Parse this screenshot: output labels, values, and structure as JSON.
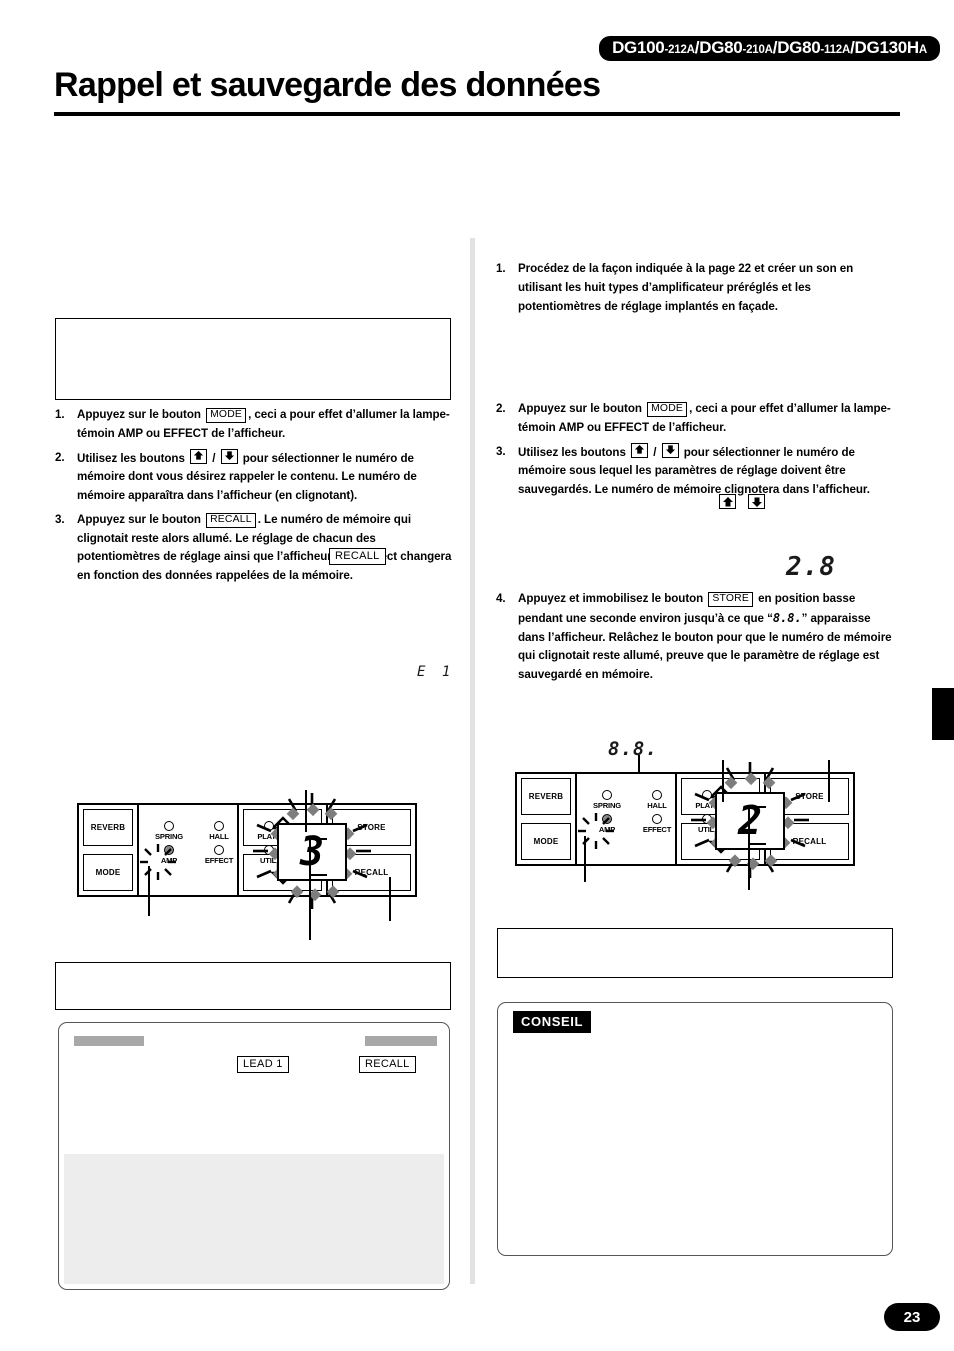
{
  "header": {
    "models_badge": "DG100-212A/DG80-210A/DG80-112A/DG130HA",
    "models": [
      {
        "name": "DG100",
        "suffix": "-212A"
      },
      {
        "name": "DG80",
        "suffix": "-210A"
      },
      {
        "name": "DG80",
        "suffix": "-112A"
      },
      {
        "name": "DG130H",
        "suffix": "A"
      }
    ],
    "title": "Rappel et sauvegarde des données"
  },
  "left_column": {
    "steps": [
      {
        "num": "1.",
        "parts": [
          {
            "t": "text",
            "v": "Appuyez sur le bouton "
          },
          {
            "t": "keycap",
            "v": "MODE"
          },
          {
            "t": "text",
            "v": ",  ceci a pour effet d’allumer la lampe-témoin AMP ou EFFECT de l’afficheur."
          }
        ]
      },
      {
        "num": "2.",
        "parts": [
          {
            "t": "text",
            "v": "Utilisez les boutons "
          },
          {
            "t": "arrow-up",
            "v": "up-arrow-key"
          },
          {
            "t": "text",
            "v": " / "
          },
          {
            "t": "arrow-down",
            "v": "down-arrow-key"
          },
          {
            "t": "text",
            "v": " pour sélectionner le numéro de mémoire dont vous désirez rappeler le contenu. Le numéro de mémoire apparaîtra dans l’afficheur (en clignotant)."
          }
        ]
      },
      {
        "num": "3.",
        "parts": [
          {
            "t": "text",
            "v": "Appuyez sur le bouton "
          },
          {
            "t": "keycap",
            "v": "RECALL"
          },
          {
            "t": "text",
            "v": ". Le numéro de mémoire qui clignotait reste alors allumé. Le réglage de chacun des potentiomètres de réglage ainsi que l’afficheur Amp Select changera en fonction des données rappelées de la mémoire."
          }
        ]
      }
    ],
    "callout_recall": "RECALL",
    "segment_readout": "E 1",
    "panel": {
      "left_buttons": [
        "REVERB",
        "MODE"
      ],
      "leds_top": [
        {
          "label": "SPRING",
          "lit": false
        },
        {
          "label": "HALL",
          "lit": false
        },
        {
          "label": "PLATE",
          "lit": false
        }
      ],
      "leds_bottom": [
        {
          "label": "AMP",
          "lit": true
        },
        {
          "label": "EFFECT",
          "lit": false
        },
        {
          "label": "UTIL.",
          "lit": false
        }
      ],
      "display_value": "3",
      "display_flashing": true,
      "arrow_buttons": [
        "up-arrow",
        "down-arrow"
      ],
      "command_buttons": [
        "STORE",
        "RECALL"
      ]
    },
    "note_box_labels": {
      "lead_1": "LEAD 1",
      "recall": "RECALL"
    }
  },
  "right_column": {
    "steps": [
      {
        "num": "1.",
        "parts": [
          {
            "t": "text",
            "v": "Procédez de la façon indiquée à la page 22 et créer un son en utilisant les huit types d’amplificateur préréglés et les potentiomètres de réglage implantés en façade."
          }
        ]
      },
      {
        "num": "2.",
        "parts": [
          {
            "t": "text",
            "v": "Appuyez sur le bouton "
          },
          {
            "t": "keycap",
            "v": "MODE"
          },
          {
            "t": "text",
            "v": ",  ceci a pour effet d’allumer la lampe-témoin AMP ou EFFECT de l’afficheur."
          }
        ]
      },
      {
        "num": "3.",
        "parts": [
          {
            "t": "text",
            "v": "Utilisez les boutons "
          },
          {
            "t": "arrow-up",
            "v": "up-arrow-key"
          },
          {
            "t": "text",
            "v": " / "
          },
          {
            "t": "arrow-down",
            "v": "down-arrow-key"
          },
          {
            "t": "text",
            "v": " pour sélectionner le numéro de mémoire sous lequel les paramètres de réglage doivent être sauvegardés. Le numéro de mémoire clignotera dans l’afficheur."
          }
        ]
      },
      {
        "num": "4.",
        "parts": [
          {
            "t": "text",
            "v": "Appuyez et immobilisez le bouton "
          },
          {
            "t": "keycap",
            "v": "STORE"
          },
          {
            "t": "text",
            "v": " en position basse pendant une seconde environ jusqu’à ce que “"
          },
          {
            "t": "seg",
            "v": "8.8."
          },
          {
            "t": "text",
            "v": "” apparaisse dans l’afficheur. Relâchez le bouton pour que le numéro de mémoire qui clignotait reste allumé, preuve que le paramètre de réglage est sauvegardé en mémoire."
          }
        ]
      }
    ],
    "segment_readout_28": "2.8",
    "segment_readout_88": "8.8.",
    "panel": {
      "left_buttons": [
        "REVERB",
        "MODE"
      ],
      "leds_top": [
        {
          "label": "SPRING",
          "lit": false
        },
        {
          "label": "HALL",
          "lit": false
        },
        {
          "label": "PLATE",
          "lit": false
        }
      ],
      "leds_bottom": [
        {
          "label": "AMP",
          "lit": true
        },
        {
          "label": "EFFECT",
          "lit": false
        },
        {
          "label": "UTIL.",
          "lit": false
        }
      ],
      "display_value": "2",
      "display_flashing": true,
      "arrow_buttons": [
        "up-arrow",
        "down-arrow"
      ],
      "command_buttons": [
        "STORE",
        "RECALL"
      ]
    },
    "tip_tag": "CONSEIL"
  },
  "footer": {
    "page_number": "23"
  }
}
